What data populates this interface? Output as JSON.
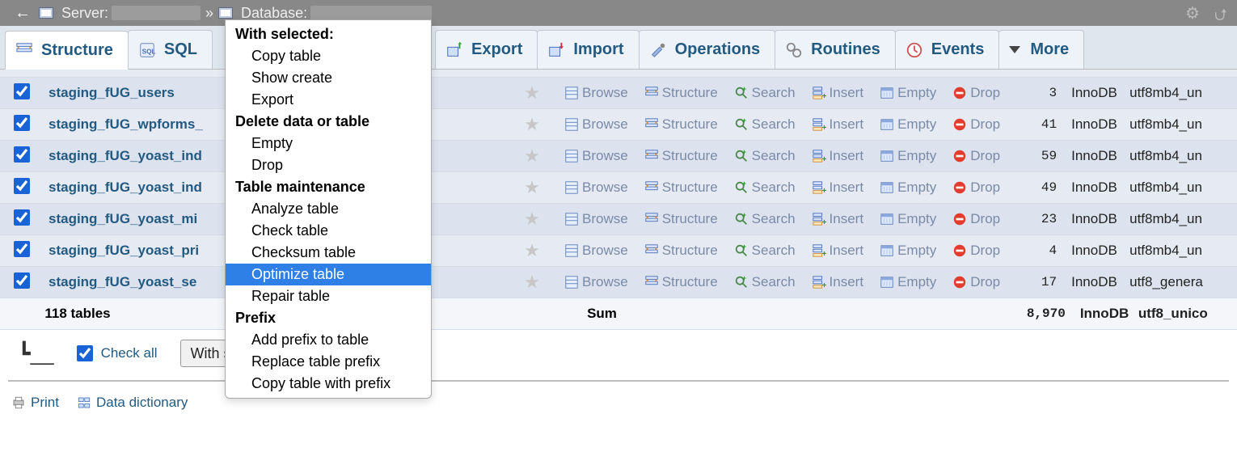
{
  "breadcrumb": {
    "server_label": "Server:",
    "database_label": "Database:"
  },
  "tabs": {
    "structure": "Structure",
    "sql": "SQL",
    "export": "Export",
    "import": "Import",
    "operations": "Operations",
    "routines": "Routines",
    "events": "Events",
    "more": "More"
  },
  "action_labels": {
    "browse": "Browse",
    "structure": "Structure",
    "search": "Search",
    "insert": "Insert",
    "empty": "Empty",
    "drop": "Drop"
  },
  "context_menu": {
    "with_selected": "With selected:",
    "copy_table": "Copy table",
    "show_create": "Show create",
    "export": "Export",
    "delete_header": "Delete data or table",
    "empty": "Empty",
    "drop": "Drop",
    "maint_header": "Table maintenance",
    "analyze": "Analyze table",
    "check": "Check table",
    "checksum": "Checksum table",
    "optimize": "Optimize table",
    "repair": "Repair table",
    "prefix_header": "Prefix",
    "add_prefix": "Add prefix to table",
    "replace_prefix": "Replace table prefix",
    "copy_with_prefix": "Copy table with prefix"
  },
  "rows": [
    {
      "name": "staging_fUG_users",
      "rows": "3",
      "engine": "InnoDB",
      "collation": "utf8mb4_un"
    },
    {
      "name": "staging_fUG_wpforms_",
      "rows": "41",
      "engine": "InnoDB",
      "collation": "utf8mb4_un"
    },
    {
      "name": "staging_fUG_yoast_ind",
      "rows": "59",
      "engine": "InnoDB",
      "collation": "utf8mb4_un"
    },
    {
      "name": "staging_fUG_yoast_ind",
      "rows": "49",
      "engine": "InnoDB",
      "collation": "utf8mb4_un"
    },
    {
      "name": "staging_fUG_yoast_mi",
      "rows": "23",
      "engine": "InnoDB",
      "collation": "utf8mb4_un"
    },
    {
      "name": "staging_fUG_yoast_pri",
      "rows": "4",
      "engine": "InnoDB",
      "collation": "utf8mb4_un"
    },
    {
      "name": "staging_fUG_yoast_se",
      "rows": "17",
      "engine": "InnoDB",
      "collation": "utf8_genera"
    }
  ],
  "sum_row": {
    "label": "118 tables",
    "sum": "Sum",
    "rows": "8,970",
    "engine": "InnoDB",
    "collation": "utf8_unico"
  },
  "footer": {
    "checkall": "Check all",
    "with_selected": "With selected:"
  },
  "bottom": {
    "print": "Print",
    "dict": "Data dictionary"
  }
}
